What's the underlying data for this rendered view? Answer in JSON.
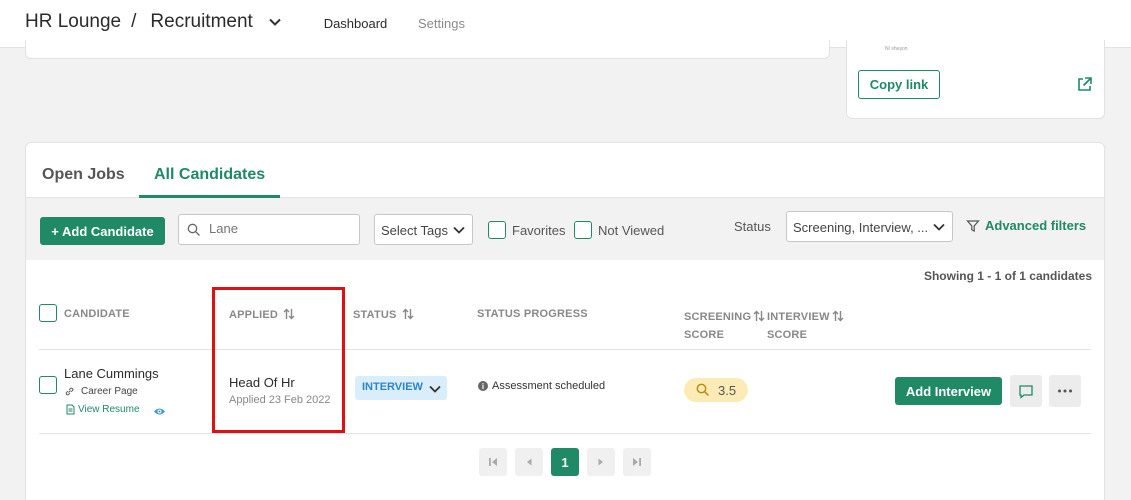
{
  "header": {
    "org": "HR Lounge",
    "separator": "/",
    "section": "Recruitment",
    "tabs": {
      "dashboard": "Dashboard",
      "settings": "Settings"
    }
  },
  "share_card": {
    "tiny_text": "N/ sheşon",
    "copy_link": "Copy link"
  },
  "main": {
    "tabs": {
      "open_jobs": "Open Jobs",
      "all_candidates": "All Candidates"
    },
    "toolbar": {
      "add_candidate": "+ Add Candidate",
      "search_placeholder": "Lane",
      "select_tags": "Select Tags",
      "favorites": "Favorites",
      "not_viewed": "Not Viewed",
      "status_label": "Status",
      "status_value": "Screening, Interview, ...",
      "advanced_filters": "Advanced filters"
    },
    "showing": "Showing 1 - 1 of 1 candidates",
    "columns": {
      "candidate": "CANDIDATE",
      "applied": "APPLIED",
      "status": "STATUS",
      "status_progress": "STATUS PROGRESS",
      "screening_1": "SCREENING",
      "screening_2": "SCORE",
      "interview_1": "INTERVIEW",
      "interview_2": "SCORE"
    },
    "row": {
      "name": "Lane Cummings",
      "source": "Career Page",
      "view_resume": "View Resume",
      "job": "Head Of Hr",
      "applied_date": "Applied 23 Feb 2022",
      "status": "INTERVIEW",
      "progress": "Assessment scheduled",
      "screening_score": "3.5",
      "add_interview": "Add Interview"
    },
    "pagination": {
      "current": "1"
    }
  },
  "colors": {
    "accent": "#1f8a65",
    "highlight": "#e01010",
    "status_pill": "#d9eefa",
    "score_pill": "#fcebb5"
  }
}
